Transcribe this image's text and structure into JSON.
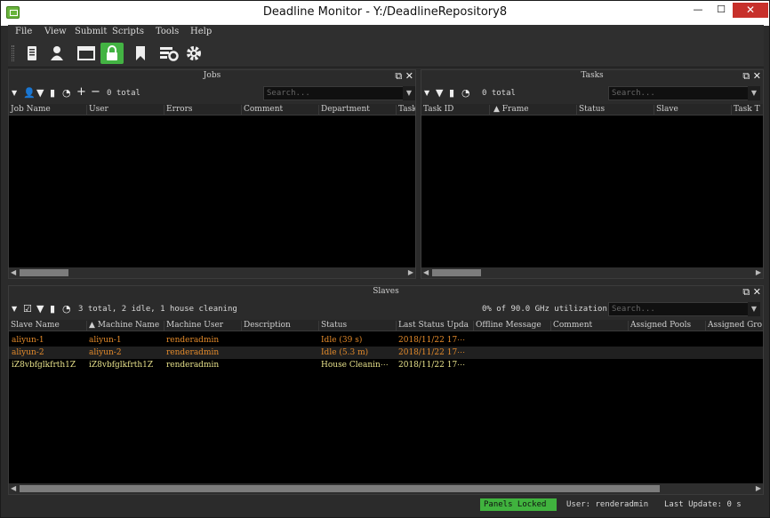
{
  "window": {
    "title": "Deadline Monitor  -  Y:/DeadlineRepository8",
    "minimize": "—",
    "maximize": "☐",
    "close": "✕"
  },
  "menu": [
    "File",
    "View",
    "Submit",
    "Scripts",
    "Tools",
    "Help"
  ],
  "toolbar": {
    "icons": [
      "repository-icon",
      "user-icon",
      "window-icon",
      "lock-icon",
      "bookmark-icon",
      "settings-panel-icon",
      "gear-icon"
    ]
  },
  "jobs_panel": {
    "title": "Jobs",
    "count_text": "0 total",
    "search_placeholder": "Search...",
    "columns": [
      "Job Name",
      "User",
      "Errors",
      "Comment",
      "Department",
      "Task"
    ]
  },
  "tasks_panel": {
    "title": "Tasks",
    "count_text": "0 total",
    "search_placeholder": "Search...",
    "columns": [
      "Task ID",
      "▲ Frame",
      "Status",
      "Slave",
      "Task T"
    ]
  },
  "slaves_panel": {
    "title": "Slaves",
    "count_text": "3 total, 2 idle, 1 house cleaning",
    "utilization": "0% of 90.0 GHz utilization",
    "search_placeholder": "Search...",
    "columns": [
      "Slave Name",
      "▲ Machine Name",
      "Machine User",
      "Description",
      "Status",
      "Last Status Upda",
      "Offline Message",
      "Comment",
      "Assigned Pools",
      "Assigned Gro"
    ],
    "rows": [
      {
        "slave": "aliyun-1",
        "machine": "aliyun-1",
        "user": "renderadmin",
        "status": "Idle (39 s)",
        "updated": "2018/11/22 17⋯",
        "color": "#e38a2a"
      },
      {
        "slave": "aliyun-2",
        "machine": "aliyun-2",
        "user": "renderadmin",
        "status": "Idle (5.3 m)",
        "updated": "2018/11/22 17⋯",
        "color": "#e38a2a"
      },
      {
        "slave": "iZ8vbfglkfrth1Z",
        "machine": "iZ8vbfglkfrth1Z",
        "user": "renderadmin",
        "status": "House Cleanin⋯",
        "updated": "2018/11/22 17⋯",
        "color": "#e6e08a"
      }
    ]
  },
  "statusbar": {
    "panels_locked": "Panels Locked",
    "user": "User: renderadmin",
    "last_update": "Last Update: 0 s"
  },
  "colors": {
    "accent_green": "#43b343",
    "idle_orange": "#e38a2a",
    "cleaning_yellow": "#e6e08a"
  }
}
